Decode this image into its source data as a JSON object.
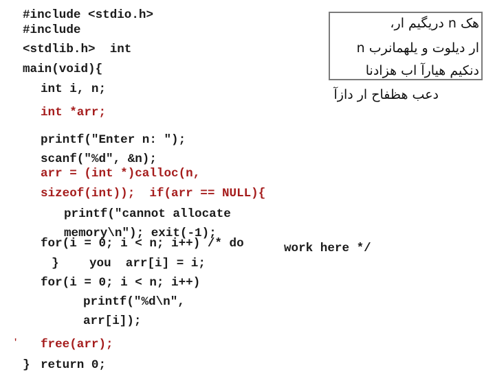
{
  "code_lines": {
    "l1": "#include <stdio.h>",
    "l2": "#include",
    "l3": "<stdlib.h>  int",
    "l4": "main(void){",
    "l5": "int i, n;",
    "l6": "int *arr;",
    "l7": "printf(\"Enter n: \");",
    "l8": "scanf(\"%d\", &n);",
    "l9": "arr = (int *)calloc(n,",
    "l10": "sizeof(int));  if(arr == NULL){",
    "l11": "printf(\"cannot allocate",
    "l12": "memory\\n\"); exit(-1);",
    "l13": "for(i = 0; i < n; i++) /* do",
    "l13b": "work here */",
    "l14a": "}",
    "l14b": "you  arr[i] = i;",
    "l15": "for(i = 0; i < n; i++)",
    "l16": "printf(\"%d\\n\",",
    "l17": "arr[i]);",
    "l18a": "'",
    "l18": "free(arr);",
    "l19a": "}",
    "l19": "return 0;"
  },
  "note": {
    "line1": "هک n دریگیم ار،",
    "line2": "ار دیلوت و يلهمانرب n",
    "line3": "دنکيم هیارآ اب هزادنا",
    "line4": "دعب هظفاح ار دازآ"
  },
  "colors": {
    "code": "#1a1a1a",
    "highlight": "#a51c1c",
    "box_border": "#7a7a7a"
  }
}
